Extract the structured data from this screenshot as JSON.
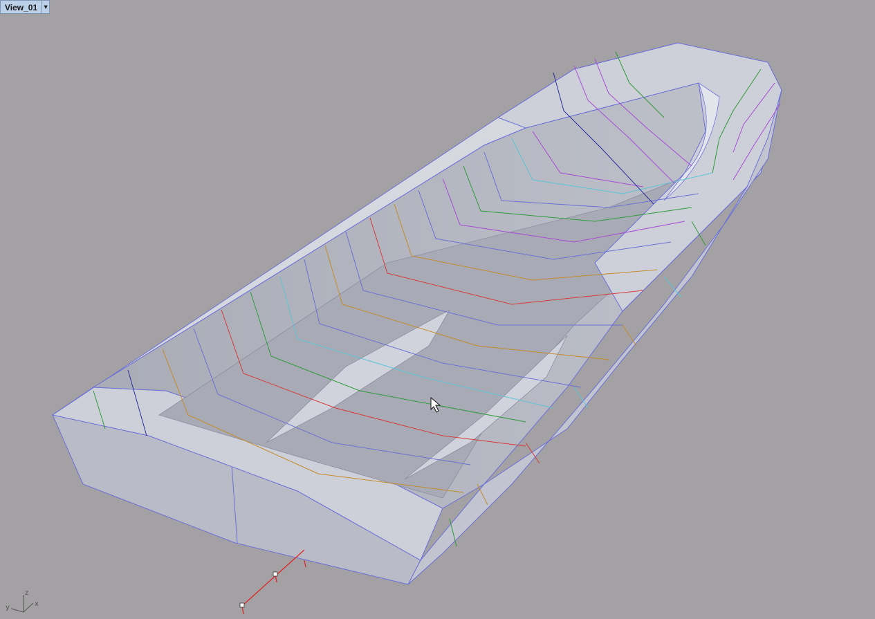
{
  "viewport": {
    "tab_title": "View_01",
    "tab_menu_icon": "chevron-down-icon",
    "background_color": "#a3a1a3",
    "axis_labels": {
      "x": "x",
      "y": "y",
      "z": "z"
    },
    "cursor_icon": "mouse-pointer-icon"
  },
  "model": {
    "surface_color": "#c7cad3",
    "edge_color": "#6b6fd6",
    "isocurve_colors": [
      "#2a2f9a",
      "#a64bd6",
      "#2f9a3a",
      "#5cc4d6",
      "#c48a2a",
      "#d63a3a",
      "#6b6fd6"
    ]
  }
}
